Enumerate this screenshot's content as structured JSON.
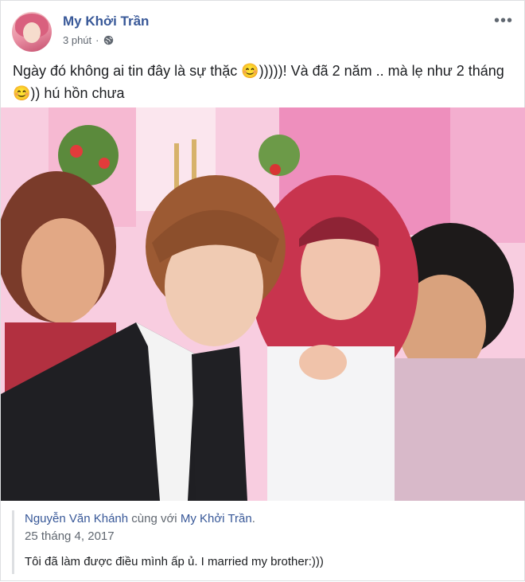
{
  "post": {
    "author": "My Khởi Trần",
    "time": "3 phút",
    "privacy_icon": "globe-icon",
    "menu_icon": "more-icon",
    "text": "Ngày đó không ai tin đây là sự thặc 😊)))))! Và đã 2 năm .. mà lẹ như 2 tháng 😊)) hú hồn chưa"
  },
  "shared_post": {
    "author": "Nguyễn Văn Khánh",
    "with_text": "cùng với",
    "tagged": "My Khởi Trần",
    "date": "25 tháng 4, 2017",
    "text": "Tôi đã làm được điều mình ấp ủ. I married my brother:)))"
  },
  "colors": {
    "link": "#385898",
    "muted": "#606770",
    "photo_background": "#f6c8dc"
  }
}
